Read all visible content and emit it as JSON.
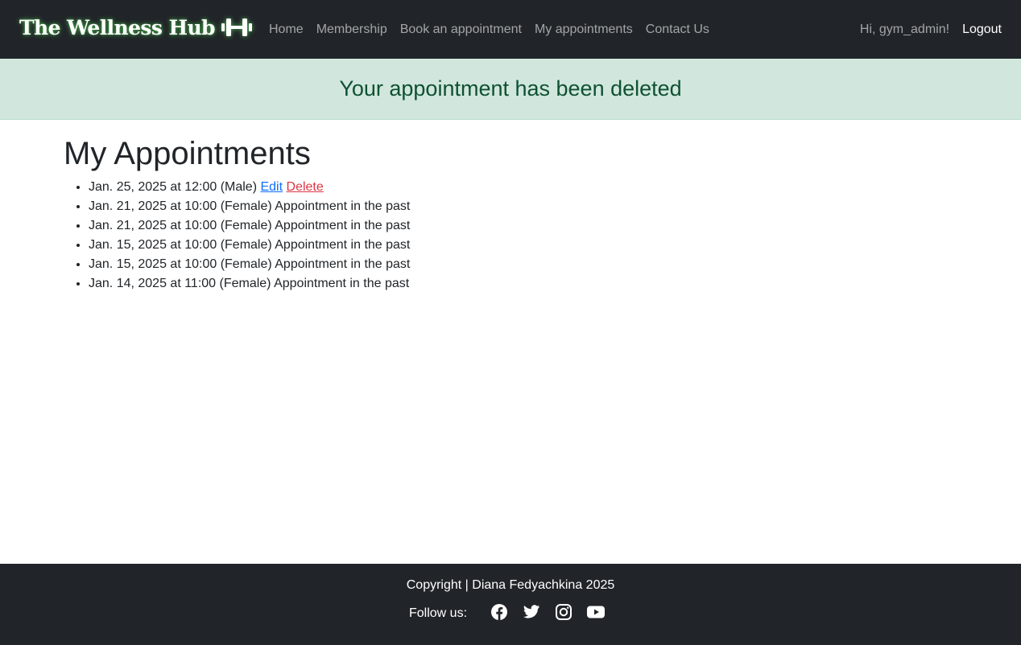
{
  "navbar": {
    "brand": "The Wellness Hub",
    "brand_icon": "dumbbell-icon",
    "links": [
      {
        "label": "Home"
      },
      {
        "label": "Membership"
      },
      {
        "label": "Book an appointment"
      },
      {
        "label": "My appointments"
      },
      {
        "label": "Contact Us"
      }
    ],
    "greeting": "Hi, gym_admin!",
    "logout": "Logout"
  },
  "alert": {
    "message": "Your appointment has been deleted",
    "color": "#0f5132",
    "background": "#d1e7dd"
  },
  "main": {
    "title": "My Appointments",
    "appointments": [
      {
        "text": "Jan. 25, 2025 at 12:00 (Male)",
        "edit": "Edit",
        "delete": "Delete"
      },
      {
        "text": "Jan. 21, 2025 at 10:00 (Female) Appointment in the past"
      },
      {
        "text": "Jan. 21, 2025 at 10:00 (Female) Appointment in the past"
      },
      {
        "text": "Jan. 15, 2025 at 10:00 (Female) Appointment in the past"
      },
      {
        "text": "Jan. 15, 2025 at 10:00 (Female) Appointment in the past"
      },
      {
        "text": "Jan. 14, 2025 at 11:00 (Female) Appointment in the past"
      }
    ]
  },
  "footer": {
    "copyright": "Copyright | Diana Fedyachkina 2025",
    "follow_label": "Follow us:",
    "social_icons": [
      "facebook-icon",
      "twitter-icon",
      "instagram-icon",
      "youtube-icon"
    ]
  },
  "colors": {
    "dark": "#212529",
    "edit_link": "#0d6efd",
    "delete_link": "#dc3545"
  }
}
